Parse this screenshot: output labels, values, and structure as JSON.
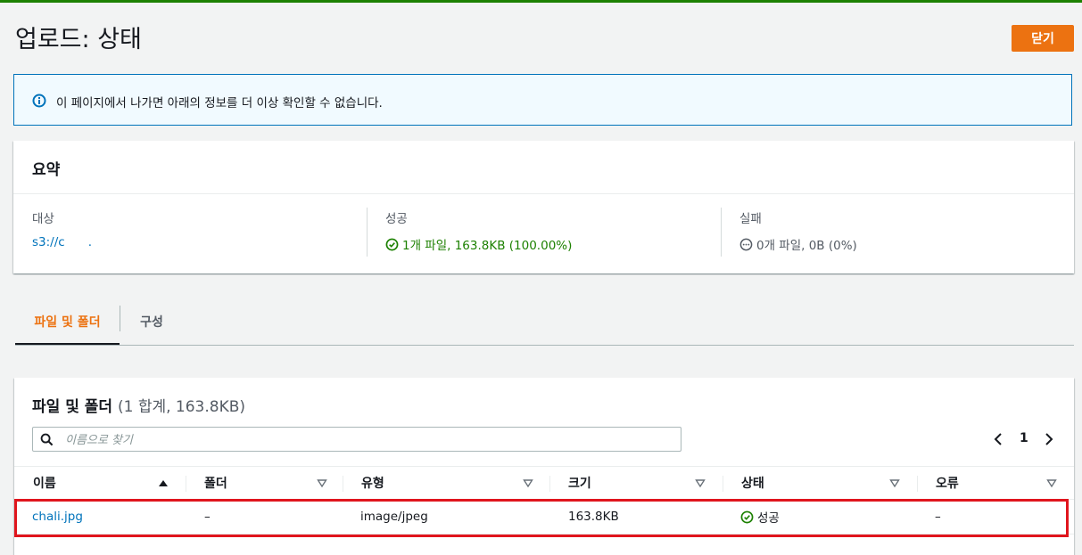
{
  "page": {
    "title": "업로드: 상태",
    "close_label": "닫기"
  },
  "alert": {
    "icon": "info-icon",
    "text": "이 페이지에서 나가면 아래의 정보를 더 이상 확인할 수 없습니다."
  },
  "summary": {
    "title": "요약",
    "destination": {
      "label": "대상",
      "value": "s3://c",
      "value_tail": "."
    },
    "success": {
      "label": "성공",
      "value": "1개 파일, 163.8KB (100.00%)",
      "icon": "check-circle-icon"
    },
    "failure": {
      "label": "실패",
      "value": "0개 파일, 0B (0%)",
      "icon": "ellipsis-circle-icon"
    }
  },
  "tabs": [
    {
      "label": "파일 및 폴더",
      "active": true
    },
    {
      "label": "구성",
      "active": false
    }
  ],
  "files": {
    "title": "파일 및 폴더",
    "count": "(1 합계, 163.8KB)",
    "search_placeholder": "이름으로 찾기",
    "page": "1",
    "columns": [
      "이름",
      "폴더",
      "유형",
      "크기",
      "상태",
      "오류"
    ],
    "rows": [
      {
        "name": "chali.jpg",
        "folder": "–",
        "type": "image/jpeg",
        "size": "163.8KB",
        "status": "성공",
        "error": "–"
      }
    ]
  },
  "colors": {
    "accent": "#ec7211",
    "success": "#1d8102",
    "link": "#0073bb",
    "highlight": "#e0151d"
  }
}
